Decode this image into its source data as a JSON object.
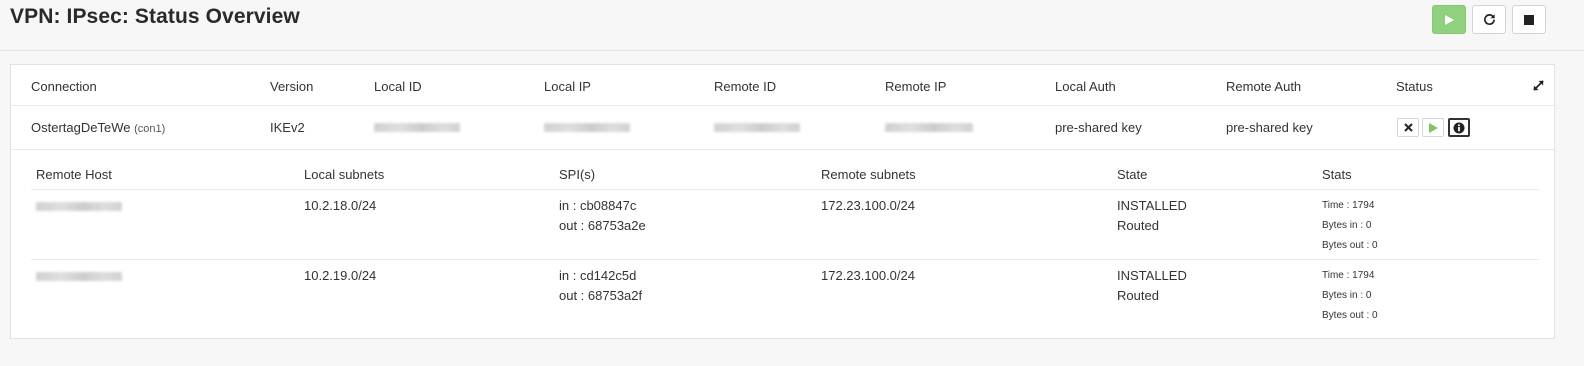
{
  "page": {
    "title": "VPN: IPsec: Status Overview"
  },
  "toolbar": {
    "start_icon": "play-icon",
    "restart_icon": "refresh-icon",
    "stop_icon": "stop-icon",
    "start_color": "#8fd17e"
  },
  "table": {
    "headers": {
      "connection": "Connection",
      "version": "Version",
      "local_id": "Local ID",
      "local_ip": "Local IP",
      "remote_id": "Remote ID",
      "remote_ip": "Remote IP",
      "local_auth": "Local Auth",
      "remote_auth": "Remote Auth",
      "status": "Status"
    },
    "row": {
      "connection": "OstertagDeTeWe",
      "connection_tag": "(con1)",
      "version": "IKEv2",
      "local_auth": "pre-shared key",
      "remote_auth": "pre-shared key",
      "actions": [
        "close-icon",
        "play-icon",
        "info-icon"
      ]
    }
  },
  "sa": {
    "headers": {
      "remote_host": "Remote Host",
      "local_subnets": "Local subnets",
      "spis": "SPI(s)",
      "remote_subnets": "Remote subnets",
      "state": "State",
      "stats": "Stats"
    },
    "rows": [
      {
        "local_subnet": "10.2.18.0/24",
        "spi_in": "in : cb08847c",
        "spi_out": "out : 68753a2e",
        "remote_subnet": "172.23.100.0/24",
        "state": "INSTALLED",
        "mode": "Routed",
        "time": "Time : 1794",
        "bytes_in": "Bytes in : 0",
        "bytes_out": "Bytes out : 0"
      },
      {
        "local_subnet": "10.2.19.0/24",
        "spi_in": "in : cd142c5d",
        "spi_out": "out : 68753a2f",
        "remote_subnet": "172.23.100.0/24",
        "state": "INSTALLED",
        "mode": "Routed",
        "time": "Time : 1794",
        "bytes_in": "Bytes in : 0",
        "bytes_out": "Bytes out : 0"
      }
    ]
  }
}
